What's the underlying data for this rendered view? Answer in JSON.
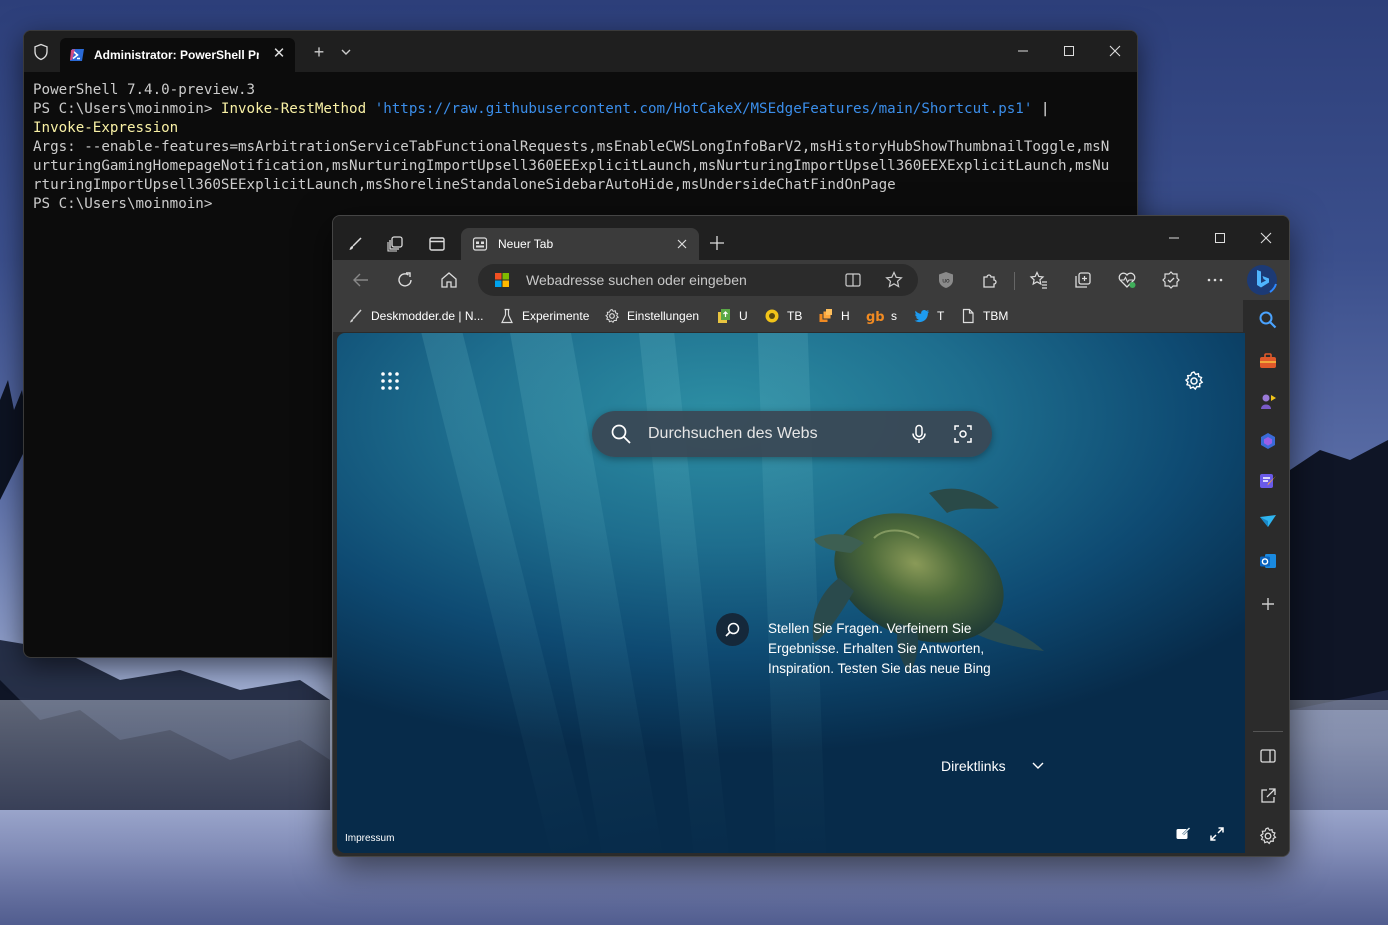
{
  "terminal": {
    "tab_title": "Administrator: PowerShell Pre",
    "lines": {
      "version": "PowerShell 7.4.0-preview.3",
      "prompt1": "PS C:\\Users\\moinmoin> ",
      "cmd1": "Invoke-RestMethod",
      "url": "'https://raw.githubusercontent.com/HotCakeX/MSEdgeFeatures/main/Shortcut.ps1'",
      "pipe": " |",
      "cmd2": "Invoke-Expression",
      "args": "Args: --enable-features=msArbitrationServiceTabFunctionalRequests,msEnableCWSLongInfoBarV2,msHistoryHubShowThumbnailToggle,msNurturingGamingHomepageNotification,msNurturingImportUpsell360EEExplicitLaunch,msNurturingImportUpsell360EEXExplicitLaunch,msNurturingImportUpsell360SEExplicitLaunch,msShorelineStandaloneSidebarAutoHide,msUndersideChatFindOnPage",
      "prompt2": "PS C:\\Users\\moinmoin>"
    }
  },
  "edge": {
    "tab_title": "Neuer Tab",
    "address_placeholder": "Webadresse suchen oder eingeben",
    "favorites": [
      {
        "label": "Deskmodder.de | N..."
      },
      {
        "label": "Experimente"
      },
      {
        "label": "Einstellungen"
      },
      {
        "label": "U"
      },
      {
        "label": "TB"
      },
      {
        "label": "H"
      },
      {
        "label": "s"
      },
      {
        "label": "T"
      },
      {
        "label": "TBM"
      }
    ],
    "newtab": {
      "search_placeholder": "Durchsuchen des Webs",
      "bing_text": "Stellen Sie Fragen. Verfeinern Sie Ergebnisse. Erhalten Sie Antworten, Inspiration. Testen Sie das neue Bing",
      "direktlinks": "Direktlinks",
      "impressum": "Impressum"
    }
  },
  "colors": {
    "terminal_bg": "#0c0c0c",
    "terminal_yellow": "#f9f1a5",
    "terminal_blue": "#3b8eea",
    "edge_toolbar": "#3b3b3b",
    "edge_tabstrip": "#202020",
    "ocean_blue": "#1e6e8e"
  },
  "icons": {
    "terminal": [
      "shield-icon",
      "powershell-icon",
      "close-icon",
      "plus-icon",
      "chevron-down-icon",
      "minimize-icon",
      "maximize-icon",
      "close-window-icon"
    ],
    "edge_toolbar": [
      "back-icon",
      "refresh-icon",
      "home-icon",
      "split-screen-icon",
      "favorite-star-icon",
      "ublock-icon",
      "extensions-icon",
      "favorites-icon",
      "collections-icon",
      "performance-icon",
      "browser-essentials-icon",
      "more-icon",
      "bing-chat-icon"
    ],
    "edge_sidebar": [
      "search-icon",
      "tools-icon",
      "games-icon",
      "office-icon",
      "designer-icon",
      "drop-icon",
      "outlook-icon",
      "add-icon",
      "hide-sidebar-icon",
      "open-external-icon",
      "sidebar-settings-icon"
    ]
  }
}
